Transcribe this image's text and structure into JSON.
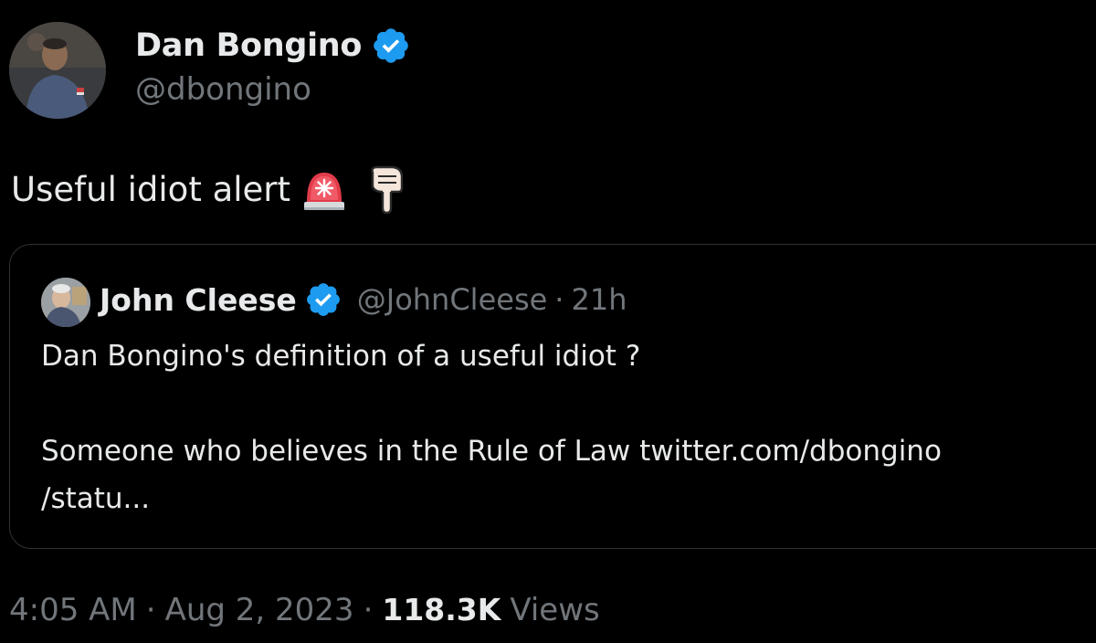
{
  "colors": {
    "background": "#000000",
    "text_primary": "#e7e9ea",
    "text_secondary": "#71767b",
    "verified_badge": "#1d9bf0",
    "card_border": "#2f3336"
  },
  "author": {
    "name": "Dan Bongino",
    "handle": "@dbongino",
    "avatar_icon": "profile-photo",
    "verified_icon": "verified-badge-icon"
  },
  "tweet": {
    "text": "Useful idiot alert",
    "emojis": [
      "police-light-emoji",
      "pointing-down-emoji"
    ]
  },
  "quoted_tweet": {
    "name": "John Cleese",
    "handle": "@JohnCleese",
    "separator": "·",
    "time_ago": "21h",
    "text": "Dan Bongino's definition of a useful idiot ?\n\nSomeone who believes in the Rule of Law twitter.com/dbongino\n/statu..."
  },
  "meta": {
    "time": "4:05 AM",
    "separator": "·",
    "date": "Aug 2, 2023",
    "views_count": "118.3K",
    "views_label": "Views"
  }
}
